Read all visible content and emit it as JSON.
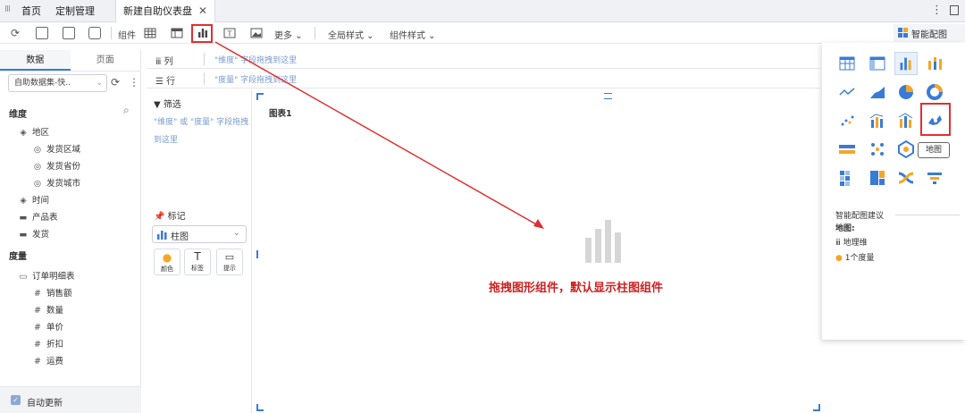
{
  "tabbar": {
    "tabs": [
      "首页",
      "定制管理",
      "新建自助仪表盘"
    ],
    "close": "✕"
  },
  "toolbar": {
    "component_label": "组件",
    "more_label": "更多",
    "global_style": "全局样式",
    "component_style": "组件样式",
    "smart_chart": "智能配图"
  },
  "left": {
    "tabs": [
      "数据",
      "页面"
    ],
    "dataset": "自助数据集-快..",
    "dim_header": "维度",
    "measure_header": "度量",
    "dims": [
      {
        "label": "地区",
        "icon": "layers-icon"
      },
      {
        "label": "发货区域",
        "icon": "geo-icon"
      },
      {
        "label": "发货省份",
        "icon": "geo-icon"
      },
      {
        "label": "发货城市",
        "icon": "geo-icon"
      },
      {
        "label": "时间",
        "icon": "layers-icon"
      },
      {
        "label": "产品表",
        "icon": "folder-icon"
      },
      {
        "label": "发货",
        "icon": "folder-icon"
      }
    ],
    "measures": [
      {
        "label": "订单明细表",
        "icon": "folder-open-icon"
      },
      {
        "label": "销售额",
        "icon": "measure-icon"
      },
      {
        "label": "数量",
        "icon": "hash-icon"
      },
      {
        "label": "单价",
        "icon": "hash-icon"
      },
      {
        "label": "折扣",
        "icon": "hash-icon"
      },
      {
        "label": "运费",
        "icon": "hash-icon"
      }
    ],
    "auto_update": "自动更新"
  },
  "shelf": {
    "col_label": "列",
    "col_hint": "\"维度\" 字段拖拽到这里",
    "row_label": "行",
    "row_hint": "\"度量\" 字段拖拽到这里"
  },
  "filter": {
    "title": "筛选",
    "hint": "\"维度\" 或 \"度量\" 字段拖拽到这里"
  },
  "marks": {
    "title": "标记",
    "type": "柱图",
    "btns": [
      "颜色",
      "标签",
      "提示"
    ]
  },
  "chart": {
    "title": "图表1"
  },
  "popup": {
    "suggest_title": "智能配图建议",
    "map_label": "地图:",
    "req1": "地理维",
    "req2": "1个度量",
    "tooltip": "地图"
  },
  "annotation": "拖拽图形组件，默认显示柱图组件"
}
